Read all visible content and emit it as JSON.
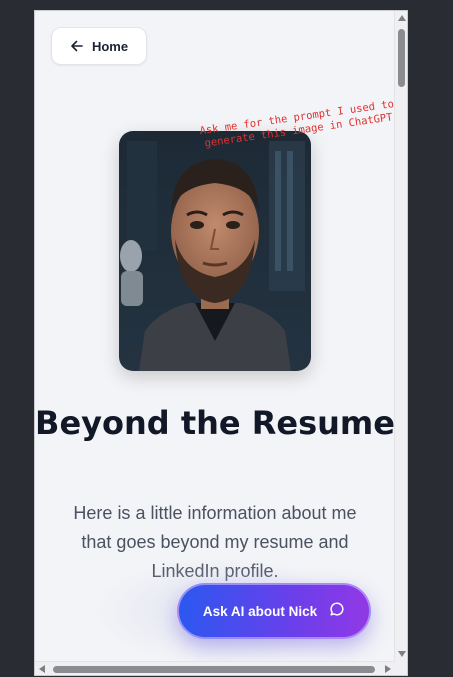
{
  "nav": {
    "home_label": "Home",
    "home_icon": "arrow-left-icon"
  },
  "profile": {
    "portrait_description_icon": "profile-photo",
    "annotation": "Ask me for the prompt I used to generate this image in ChatGPT"
  },
  "hero": {
    "title": "Beyond the Resume",
    "subtitle": "Here is a little information about me that goes beyond my resume and LinkedIn profile."
  },
  "cta": {
    "ask_label": "Ask AI about Nick",
    "ask_icon": "chat-bubble-icon"
  },
  "colors": {
    "page_bg": "#f3f4f7",
    "title": "#111827",
    "subtitle": "#4a5160",
    "annotation": "#e0322f",
    "cta_gradient_start": "#2c58f0",
    "cta_gradient_end": "#9238e6"
  }
}
